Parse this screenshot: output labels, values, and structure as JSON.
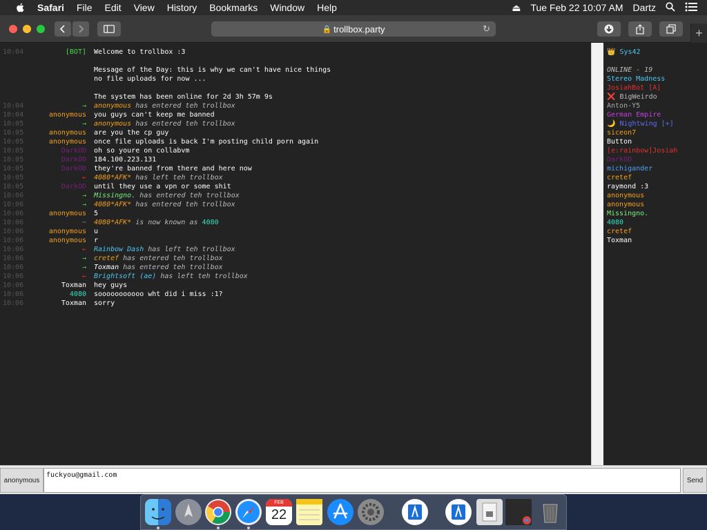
{
  "menubar": {
    "app": "Safari",
    "items": [
      "File",
      "Edit",
      "View",
      "History",
      "Bookmarks",
      "Window",
      "Help"
    ],
    "datetime": "Tue Feb 22  10:07 AM",
    "user": "Dartz"
  },
  "browser": {
    "url": "trollbox.party"
  },
  "chat": [
    {
      "time": "10:04",
      "nick": "[BOT]",
      "nick_color": "#44dd44",
      "msg": "Welcome to trollbox :3",
      "msg_color": "#ffffff"
    },
    {
      "time": "",
      "nick": "",
      "nick_color": "#ffffff",
      "msg": "",
      "msg_color": "#ffffff"
    },
    {
      "time": "",
      "nick": "",
      "nick_color": "#ffffff",
      "msg": "Message of the Day: this is why we can't have nice things",
      "msg_color": "#ffffff"
    },
    {
      "time": "",
      "nick": "",
      "nick_color": "#ffffff",
      "msg": "no file uploads for now ...",
      "msg_color": "#ffffff"
    },
    {
      "time": "",
      "nick": "",
      "nick_color": "#ffffff",
      "msg": "",
      "msg_color": "#ffffff"
    },
    {
      "time": "",
      "nick": "",
      "nick_color": "#ffffff",
      "msg": "The system has been online for 2d 3h 57m 9s",
      "msg_color": "#ffffff"
    },
    {
      "time": "10:04",
      "nick": "→",
      "nick_color": "#44dd44",
      "msg": "anonymous",
      "msg_color": "#f0a020",
      "suffix": " has entered teh trollbox"
    },
    {
      "time": "10:04",
      "nick": "anonymous",
      "nick_color": "#f0a020",
      "msg": "you guys can't keep me banned",
      "msg_color": "#ffffff"
    },
    {
      "time": "10:05",
      "nick": "→",
      "nick_color": "#44dd44",
      "msg": "anonymous",
      "msg_color": "#f0a020",
      "suffix": " has entered teh trollbox"
    },
    {
      "time": "10:05",
      "nick": "anonymous",
      "nick_color": "#f0a020",
      "msg": "are you the cp guy",
      "msg_color": "#ffffff"
    },
    {
      "time": "10:05",
      "nick": "anonymous",
      "nick_color": "#f0a020",
      "msg": "once file uploads is back I'm posting child porn again",
      "msg_color": "#ffffff"
    },
    {
      "time": "10:05",
      "nick": "DarkOD",
      "nick_color": "#7a1f7a",
      "msg": "oh so youre on collabvm",
      "msg_color": "#ffffff"
    },
    {
      "time": "10:05",
      "nick": "DarkOD",
      "nick_color": "#7a1f7a",
      "msg": "184.100.223.131",
      "msg_color": "#ffffff"
    },
    {
      "time": "10:05",
      "nick": "DarkOD",
      "nick_color": "#7a1f7a",
      "msg": "they're banned from there and here now",
      "msg_color": "#ffffff"
    },
    {
      "time": "10:05",
      "nick": "←",
      "nick_color": "#e03030",
      "msg": "4080*AFK*",
      "msg_color": "#f0a020",
      "suffix": " has left teh trollbox"
    },
    {
      "time": "10:05",
      "nick": "DarkOD",
      "nick_color": "#7a1f7a",
      "msg": "until they use a vpn or some shit",
      "msg_color": "#ffffff"
    },
    {
      "time": "10:06",
      "nick": "→",
      "nick_color": "#44dd44",
      "msg": "Missingno.",
      "msg_color": "#7ef07e",
      "suffix": " has entered teh trollbox"
    },
    {
      "time": "10:06",
      "nick": "→",
      "nick_color": "#44dd44",
      "msg": "4080*AFK*",
      "msg_color": "#f0a020",
      "suffix": " has entered teh trollbox"
    },
    {
      "time": "10:06",
      "nick": "anonymous",
      "nick_color": "#f0a020",
      "msg": "5",
      "msg_color": "#ffffff"
    },
    {
      "time": "10:06",
      "nick": "~",
      "nick_color": "#888888",
      "msg": "4080*AFK*",
      "msg_color": "#f0a020",
      "suffix": " is now known as ",
      "suffix2": "4080",
      "suffix2_color": "#33e0c0"
    },
    {
      "time": "10:06",
      "nick": "anonymous",
      "nick_color": "#f0a020",
      "msg": "u",
      "msg_color": "#ffffff"
    },
    {
      "time": "10:06",
      "nick": "anonymous",
      "nick_color": "#f0a020",
      "msg": "r",
      "msg_color": "#ffffff"
    },
    {
      "time": "10:06",
      "nick": "←",
      "nick_color": "#e03030",
      "msg": "Rainbow Dash",
      "msg_color": "#4fc6f0",
      "suffix": " has left teh trollbox"
    },
    {
      "time": "10:06",
      "nick": "→",
      "nick_color": "#44dd44",
      "msg": "cretef",
      "msg_color": "#f0a020",
      "suffix": " has entered teh trollbox"
    },
    {
      "time": "10:06",
      "nick": "→",
      "nick_color": "#44dd44",
      "msg": "Toxman",
      "msg_color": "#ffffff",
      "suffix": " has entered teh trollbox"
    },
    {
      "time": "10:06",
      "nick": "←",
      "nick_color": "#e03030",
      "msg": "Brightsoft (ae)",
      "msg_color": "#4fc6f0",
      "suffix": " has left teh trollbox"
    },
    {
      "time": "10:06",
      "nick": "Toxman",
      "nick_color": "#ffffff",
      "msg": "hey guys",
      "msg_color": "#ffffff"
    },
    {
      "time": "10:06",
      "nick": "4080",
      "nick_color": "#33e0c0",
      "msg": "sooooooooooo wht did i miss :1?",
      "msg_color": "#ffffff"
    },
    {
      "time": "10:06",
      "nick": "Toxman",
      "nick_color": "#ffffff",
      "msg": "sorry",
      "msg_color": "#ffffff"
    }
  ],
  "userlist": [
    {
      "name": "👑 Sys42",
      "color": "#4fc6f0"
    },
    {
      "name": "",
      "color": "#ffffff"
    },
    {
      "name": "ONLINE - 19",
      "color": "#bbbbbb",
      "italic": true
    },
    {
      "name": "Stereo Madness",
      "color": "#4fc6f0"
    },
    {
      "name": "JosiahBot [A]",
      "color": "#e03030"
    },
    {
      "name": "❌ BigWeirdo",
      "color": "#bbbbbb"
    },
    {
      "name": "Anton-Y5",
      "color": "#aaaaaa"
    },
    {
      "name": "German Empire",
      "color": "#c040e0"
    },
    {
      "name": "🌙 Nightwing [+]",
      "color": "#5b6ff0"
    },
    {
      "name": "siceon7",
      "color": "#f0a020"
    },
    {
      "name": "Button",
      "color": "#ffffff"
    },
    {
      "name": "[e:rainbow]Josiah",
      "color": "#e03030"
    },
    {
      "name": "DarkOD",
      "color": "#7a1f7a"
    },
    {
      "name": "michigander",
      "color": "#4fa0f0"
    },
    {
      "name": "cretef",
      "color": "#f0a020"
    },
    {
      "name": "raymond :3",
      "color": "#ffffff"
    },
    {
      "name": "anonymous",
      "color": "#f0a020"
    },
    {
      "name": "anonymous",
      "color": "#f0a020"
    },
    {
      "name": "Missingno.",
      "color": "#7ef07e"
    },
    {
      "name": "4080",
      "color": "#33e0c0"
    },
    {
      "name": "cretef",
      "color": "#f0a020"
    },
    {
      "name": "Toxman",
      "color": "#ffffff"
    }
  ],
  "input": {
    "nick": "anonymous",
    "value": "fuckyou@gmail.com",
    "send": "Send"
  },
  "dock": {
    "calendar_month": "FEB",
    "calendar_day": "22"
  }
}
